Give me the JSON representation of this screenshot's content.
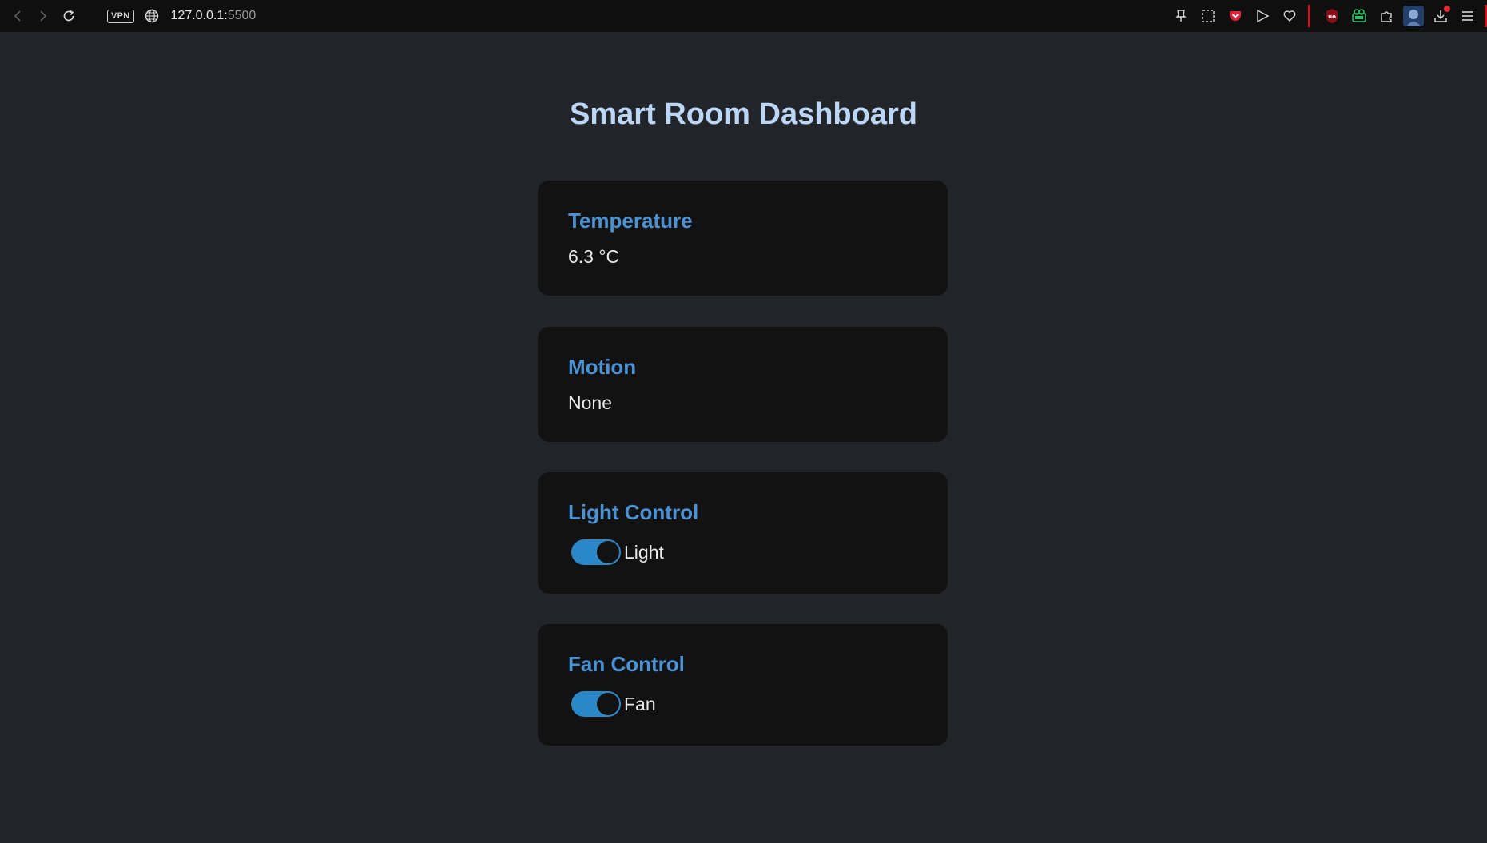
{
  "browser": {
    "vpn_label": "VPN",
    "url_host": "127.0.0.1:",
    "url_port": "5500",
    "icons": [
      "back-icon",
      "forward-icon",
      "reload-icon",
      "globe-icon",
      "pin-icon",
      "screenshot-icon",
      "pocket-icon",
      "send-icon",
      "heart-icon",
      "ublock-icon",
      "extension-icon",
      "puzzle-icon",
      "avatar",
      "download-icon",
      "menu-icon"
    ],
    "accent_color": "#c0161f"
  },
  "dashboard": {
    "title": "Smart Room Dashboard",
    "temperature": {
      "title": "Temperature",
      "value": "6.3 °C"
    },
    "motion": {
      "title": "Motion",
      "value": "None"
    },
    "light": {
      "title": "Light Control",
      "label": "Light",
      "on": true
    },
    "fan": {
      "title": "Fan Control",
      "label": "Fan",
      "on": true
    }
  },
  "colors": {
    "background": "#212429",
    "card": "#121213",
    "heading": "#bcd7f5",
    "card_title": "#4a92d4",
    "toggle_on": "#2a88c9"
  }
}
